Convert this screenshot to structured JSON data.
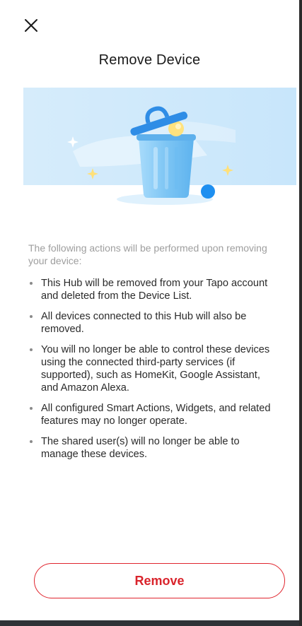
{
  "header": {
    "close_icon": "close-icon",
    "title": "Remove Device"
  },
  "illustration": {
    "icon": "trash-bin-icon",
    "colors": {
      "banner_bg": "#d9efff",
      "bin_blue": "#7cc2f3",
      "accent_yellow": "#ffe07a",
      "accent_blue": "#1e8ff0"
    }
  },
  "content": {
    "intro": "The following actions will be performed upon removing your device:",
    "actions": [
      "This Hub will be removed from your Tapo account and deleted from the Device List.",
      "All devices connected to this Hub will also be removed.",
      "You will no longer be able to control these devices using the connected third-party services (if supported), such as HomeKit, Google Assistant, and Amazon Alexa.",
      "All configured Smart Actions, Widgets, and related features may no longer operate.",
      "The shared user(s) will no longer be able to manage these devices."
    ]
  },
  "footer": {
    "remove_label": "Remove",
    "accent": "#e0252e"
  }
}
